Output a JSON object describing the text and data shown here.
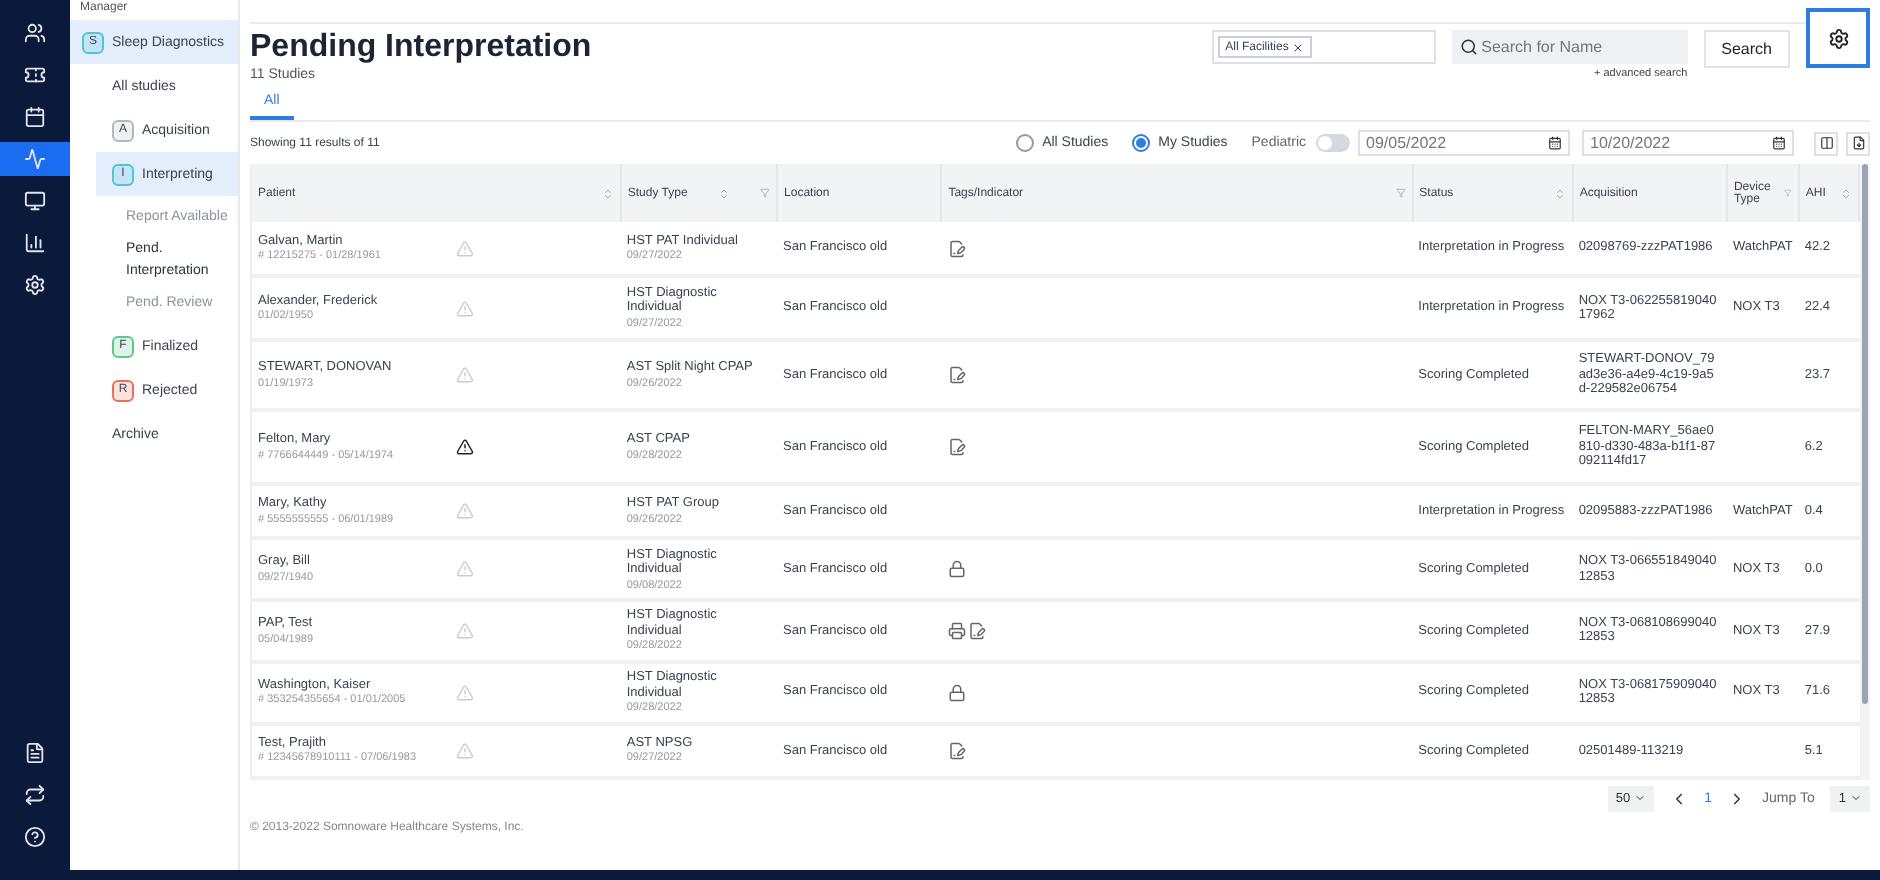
{
  "nav_icons": [
    {
      "kind": "users",
      "selected": false
    },
    {
      "kind": "psg",
      "selected": false
    },
    {
      "kind": "calendar",
      "selected": false
    },
    {
      "kind": "activity",
      "selected": true
    },
    {
      "kind": "monitor",
      "selected": false
    },
    {
      "kind": "chart",
      "selected": false
    },
    {
      "kind": "settings",
      "selected": false
    }
  ],
  "nav_bottom_icons": [
    {
      "kind": "file"
    },
    {
      "kind": "swap"
    },
    {
      "kind": "help"
    }
  ],
  "sidebar": {
    "header": "Manager",
    "items": [
      {
        "label": "Sleep Diagnostics",
        "badge": "S",
        "color": "#4fc3d9",
        "selected": true,
        "children": [
          {
            "label": "All studies",
            "selected": false
          },
          {
            "label": "Acquisition",
            "badge": "A",
            "color": "#b0b8c4",
            "selected": false
          },
          {
            "label": "Interpreting",
            "badge": "I",
            "color": "#4fc3d9",
            "selected": true,
            "children": [
              {
                "label": "Report Available",
                "selected": false
              },
              {
                "label": "Pend. Interpretation",
                "selected": true
              },
              {
                "label": "Pend. Review",
                "selected": false
              }
            ]
          },
          {
            "label": "Finalized",
            "badge": "F",
            "color": "#5cc98a",
            "selected": false
          },
          {
            "label": "Rejected",
            "badge": "R",
            "color": "#e8705c",
            "selected": false
          },
          {
            "label": "Archive",
            "selected": false
          }
        ]
      }
    ]
  },
  "page": {
    "title": "Pending Interpretation",
    "subtitle": "11 Studies"
  },
  "toolbar": {
    "facility_chip": "All Facilities",
    "search": {
      "placeholder": "Search for Name"
    },
    "search_button": "Search",
    "advanced_link": "+ advanced search"
  },
  "tabs": [
    {
      "label": "All",
      "selected": true
    }
  ],
  "filters": {
    "results": "Showing 11 results of 11",
    "scope": [
      {
        "label": "All Studies",
        "selected": false
      },
      {
        "label": "My Studies",
        "selected": true
      }
    ],
    "pediatric": {
      "label": "Pediatric",
      "on": false
    },
    "date_from": "09/05/2022",
    "date_to": "10/20/2022"
  },
  "table": {
    "columns": [
      "Patient",
      "Study Type",
      "Location",
      "Tags/Indicator",
      "Status",
      "Acquisition",
      "Device Type",
      "AHI"
    ],
    "rows": [
      {
        "patient": "Galvan, Martin",
        "info": "# 12215275 - 01/28/1961",
        "alert": false,
        "study": "HST PAT Individual",
        "date": "09/27/2022",
        "location": "San Francisco old",
        "tags": [
          {
            "kind": "doc"
          }
        ],
        "status": "Interpretation in Progress",
        "acquisition": "02098769-zzzPAT1986",
        "device": "WatchPAT",
        "ahi": "42.2"
      },
      {
        "patient": "Alexander, Frederick",
        "info": "01/02/1950",
        "alert": false,
        "study": "HST Diagnostic Individual",
        "date": "09/27/2022",
        "location": "San Francisco old",
        "tags": [],
        "status": "Interpretation in Progress",
        "acquisition": "NOX T3-06225581904017962",
        "device": "NOX T3",
        "ahi": "22.4"
      },
      {
        "patient": "STEWART, DONOVAN",
        "info": "01/19/1973",
        "alert": false,
        "study": "AST Split Night CPAP",
        "date": "09/26/2022",
        "location": "San Francisco old",
        "tags": [
          {
            "kind": "doc"
          }
        ],
        "status": "Scoring Completed",
        "acquisition": "STEWART-DONOV_79ad3e36-a4e9-4c19-9a5d-229582e06754",
        "ahi": "23.7"
      },
      {
        "patient": "Felton, Mary",
        "info": "# 7766644449 - 05/14/1974",
        "alert": true,
        "study": "AST CPAP",
        "date": "09/28/2022",
        "location": "San Francisco old",
        "tags": [
          {
            "kind": "doc"
          }
        ],
        "status": "Scoring Completed",
        "acquisition": "FELTON-MARY_56ae0810-d330-483a-b1f1-87092114fd17",
        "ahi": "6.2"
      },
      {
        "patient": "Mary, Kathy",
        "info": "# 5555555555 - 06/01/1989",
        "alert": false,
        "study": "HST PAT Group",
        "date": "09/26/2022",
        "location": "San Francisco old",
        "tags": [],
        "status": "Interpretation in Progress",
        "acquisition": "02095883-zzzPAT1986",
        "device": "WatchPAT",
        "ahi": "0.4"
      },
      {
        "patient": "Gray, Bill",
        "info": "09/27/1940",
        "alert": false,
        "study": "HST Diagnostic Individual",
        "date": "09/08/2022",
        "location": "San Francisco old",
        "tags": [
          {
            "kind": "lock"
          }
        ],
        "status": "Scoring Completed",
        "acquisition": "NOX T3-06655184904012853",
        "device": "NOX T3",
        "ahi": "0.0"
      },
      {
        "patient": "PAP, Test",
        "info": "05/04/1989",
        "alert": false,
        "study": "HST Diagnostic Individual",
        "date": "09/28/2022",
        "location": "San Francisco old",
        "tags": [
          {
            "kind": "printer"
          },
          {
            "kind": "doc"
          }
        ],
        "status": "Scoring Completed",
        "acquisition": "NOX T3-06810869904012853",
        "device": "NOX T3",
        "ahi": "27.9"
      },
      {
        "patient": "Washington, Kaiser",
        "info": "# 353254355654 - 01/01/2005",
        "alert": false,
        "study": "HST Diagnostic Individual",
        "date": "09/28/2022",
        "location": "San Francisco old",
        "tags": [
          {
            "kind": "lock"
          }
        ],
        "status": "Scoring Completed",
        "acquisition": "NOX T3-06817590904012853",
        "device": "NOX T3",
        "ahi": "71.6"
      },
      {
        "patient": "Test, Prajith",
        "info": "# 12345678910111 - 07/06/1983",
        "alert": false,
        "study": "AST NPSG",
        "date": "09/27/2022",
        "location": "San Francisco old",
        "tags": [
          {
            "kind": "doc"
          }
        ],
        "status": "Scoring Completed",
        "acquisition": "02501489-113219",
        "ahi": "5.1"
      }
    ]
  },
  "pagination": {
    "page_size": "50",
    "pages": [
      {
        "label": "1",
        "selected": true
      }
    ],
    "jump_label": "Jump To",
    "jump_value": "1"
  },
  "footer": "© 2013-2022 Somnoware Healthcare Systems, Inc."
}
